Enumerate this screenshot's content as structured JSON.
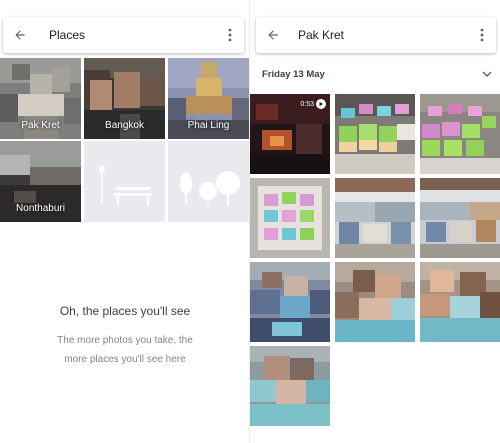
{
  "left": {
    "title": "Places",
    "places": [
      {
        "label": "Pak Kret"
      },
      {
        "label": "Bangkok"
      },
      {
        "label": "Phai Ling"
      },
      {
        "label": "Nonthaburi"
      }
    ],
    "empty_title": "Oh, the places you'll see",
    "empty_subtitle_line1": "The more photos you take, the",
    "empty_subtitle_line2": "more places you'll see here"
  },
  "right": {
    "title": "Pak Kret",
    "date_header": "Friday 13 May",
    "video_duration": "0:53"
  },
  "icons": {
    "back": "arrow-left-icon",
    "more": "more-vertical-icon",
    "expand": "chevron-down-icon",
    "play": "play-icon"
  },
  "colors": {
    "background": "#ffffff",
    "placeholder": "#e8eaed",
    "text_primary": "#202124",
    "text_secondary": "#80868b"
  }
}
